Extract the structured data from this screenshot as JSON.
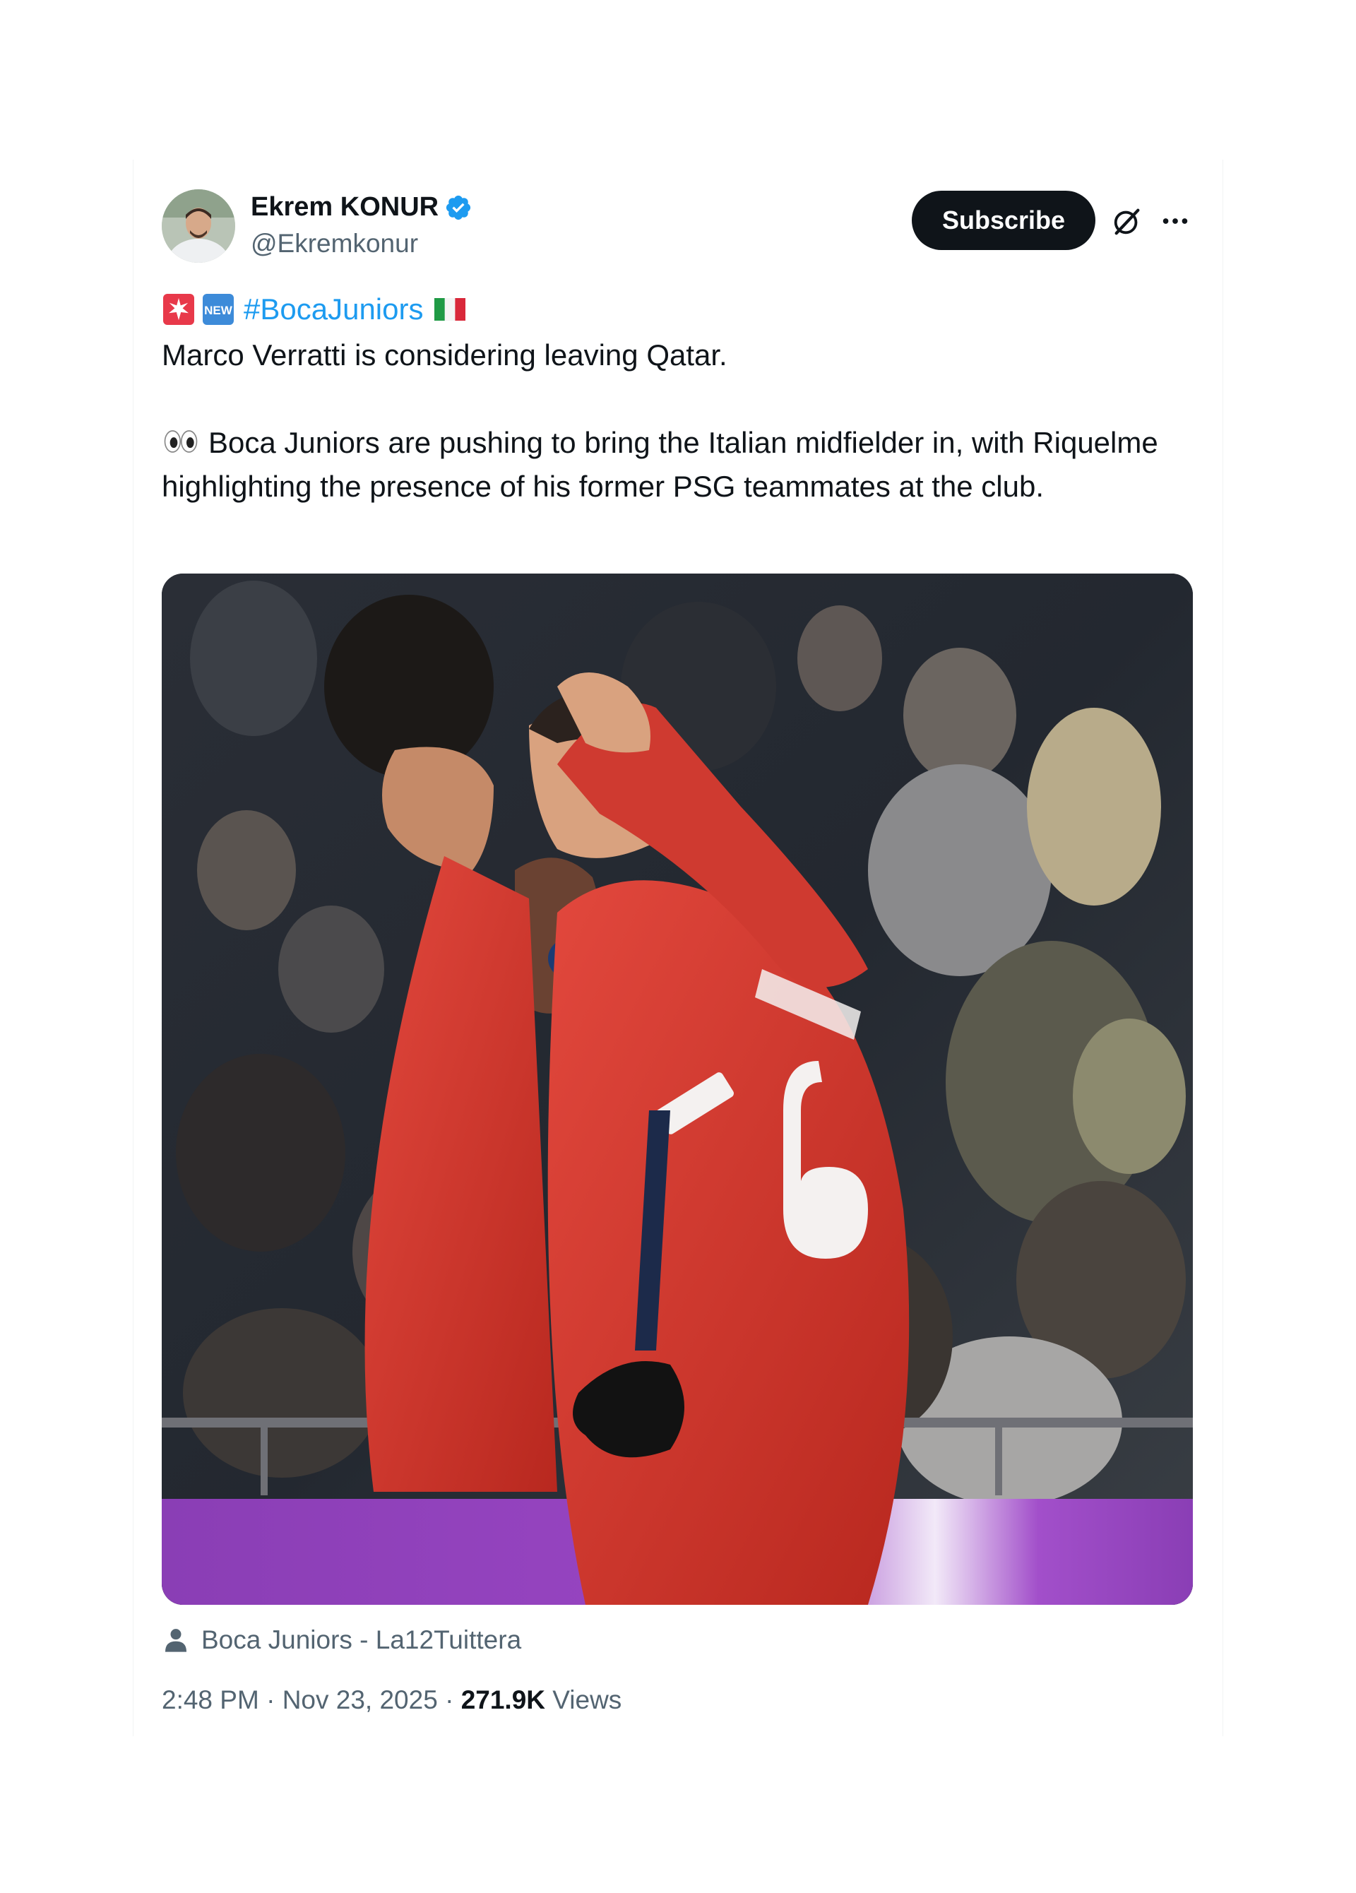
{
  "author": {
    "name": "Ekrem KONUR",
    "handle": "@Ekremkonur",
    "verified": true
  },
  "actions": {
    "subscribe_label": "Subscribe",
    "grok_icon": "grok-icon",
    "more_icon": "more-icon"
  },
  "tweet": {
    "emojis_prefix": [
      "siren-emoji",
      "new-emoji"
    ],
    "hashtag": "#BocaJuniors",
    "flag_emoji": "italy-flag-emoji",
    "line1": "Marco Verratti is considering leaving Qatar.",
    "eyes_emoji": "eyes-emoji",
    "paragraph2": "Boca Juniors are pushing to bring the Italian midfielder in, with Riquelme highlighting the presence of his former PSG teammates at the club."
  },
  "media": {
    "credit": "Boca Juniors - La12Tuittera"
  },
  "meta": {
    "time": "2:48 PM",
    "separator": "·",
    "date": "Nov 23, 2025",
    "views_count": "271.9K",
    "views_label": "Views"
  },
  "colors": {
    "link_blue": "#1d9bf0",
    "text_dark": "#0f1419",
    "text_gray": "#536471",
    "button_dark": "#0f1419"
  }
}
